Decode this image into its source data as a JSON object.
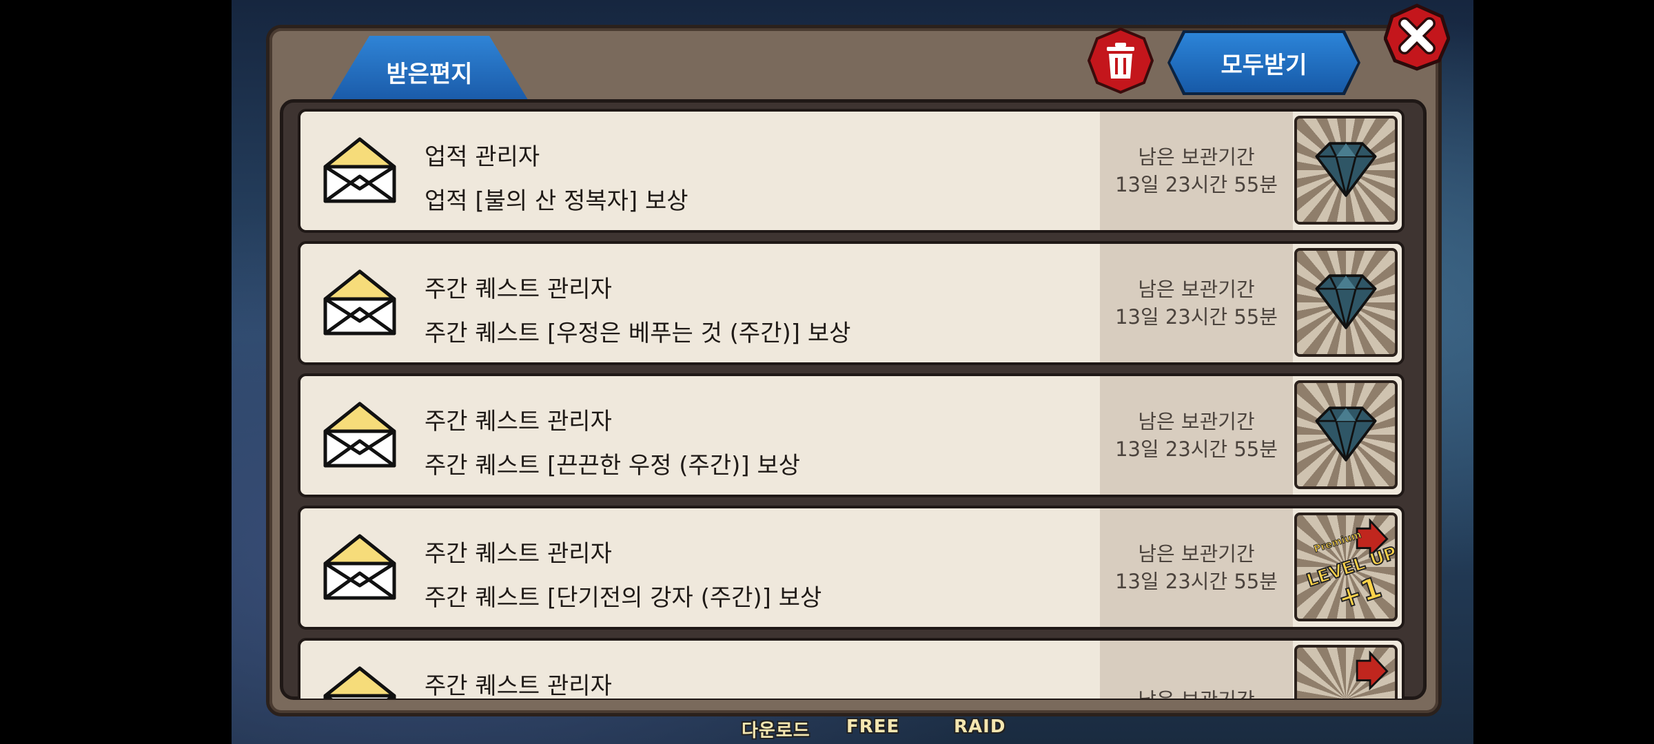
{
  "dialog": {
    "tab_label": "받은편지",
    "receive_all_label": "모두받기"
  },
  "mails": [
    {
      "sender": "업적 관리자",
      "subject": "업적 [불의 산 정복자] 보상",
      "expiry_label": "남은 보관기간",
      "expiry_time": "13일 23시간 55분",
      "reward_icon": "diamond-icon"
    },
    {
      "sender": "주간 퀘스트 관리자",
      "subject": "주간 퀘스트 [우정은 베푸는 것 (주간)] 보상",
      "expiry_label": "남은 보관기간",
      "expiry_time": "13일 23시간 55분",
      "reward_icon": "diamond-icon"
    },
    {
      "sender": "주간 퀘스트 관리자",
      "subject": "주간 퀘스트 [끈끈한 우정 (주간)] 보상",
      "expiry_label": "남은 보관기간",
      "expiry_time": "13일 23시간 55분",
      "reward_icon": "diamond-icon"
    },
    {
      "sender": "주간 퀘스트 관리자",
      "subject": "주간 퀘스트 [단기전의 강자 (주간)] 보상",
      "expiry_label": "남은 보관기간",
      "expiry_time": "13일 23시간 55분",
      "reward_icon": "level-up-ticket-icon",
      "reward_text": {
        "top": "Premium",
        "main": "LEVEL UP",
        "plus": "+1"
      }
    },
    {
      "sender": "주간 퀘스트 관리자",
      "subject": "",
      "expiry_label": "남은 보관기간",
      "expiry_time": "",
      "reward_icon": "level-up-ticket-icon"
    }
  ],
  "background_labels": [
    "다운로드",
    "FREE",
    "RAID"
  ],
  "colors": {
    "tab_blue": "#1f6bc0",
    "button_red": "#c4161c",
    "row_bg": "#efe8dc",
    "expiry_bg": "#d8cdbf",
    "frame_brown": "#7a6a5c"
  }
}
